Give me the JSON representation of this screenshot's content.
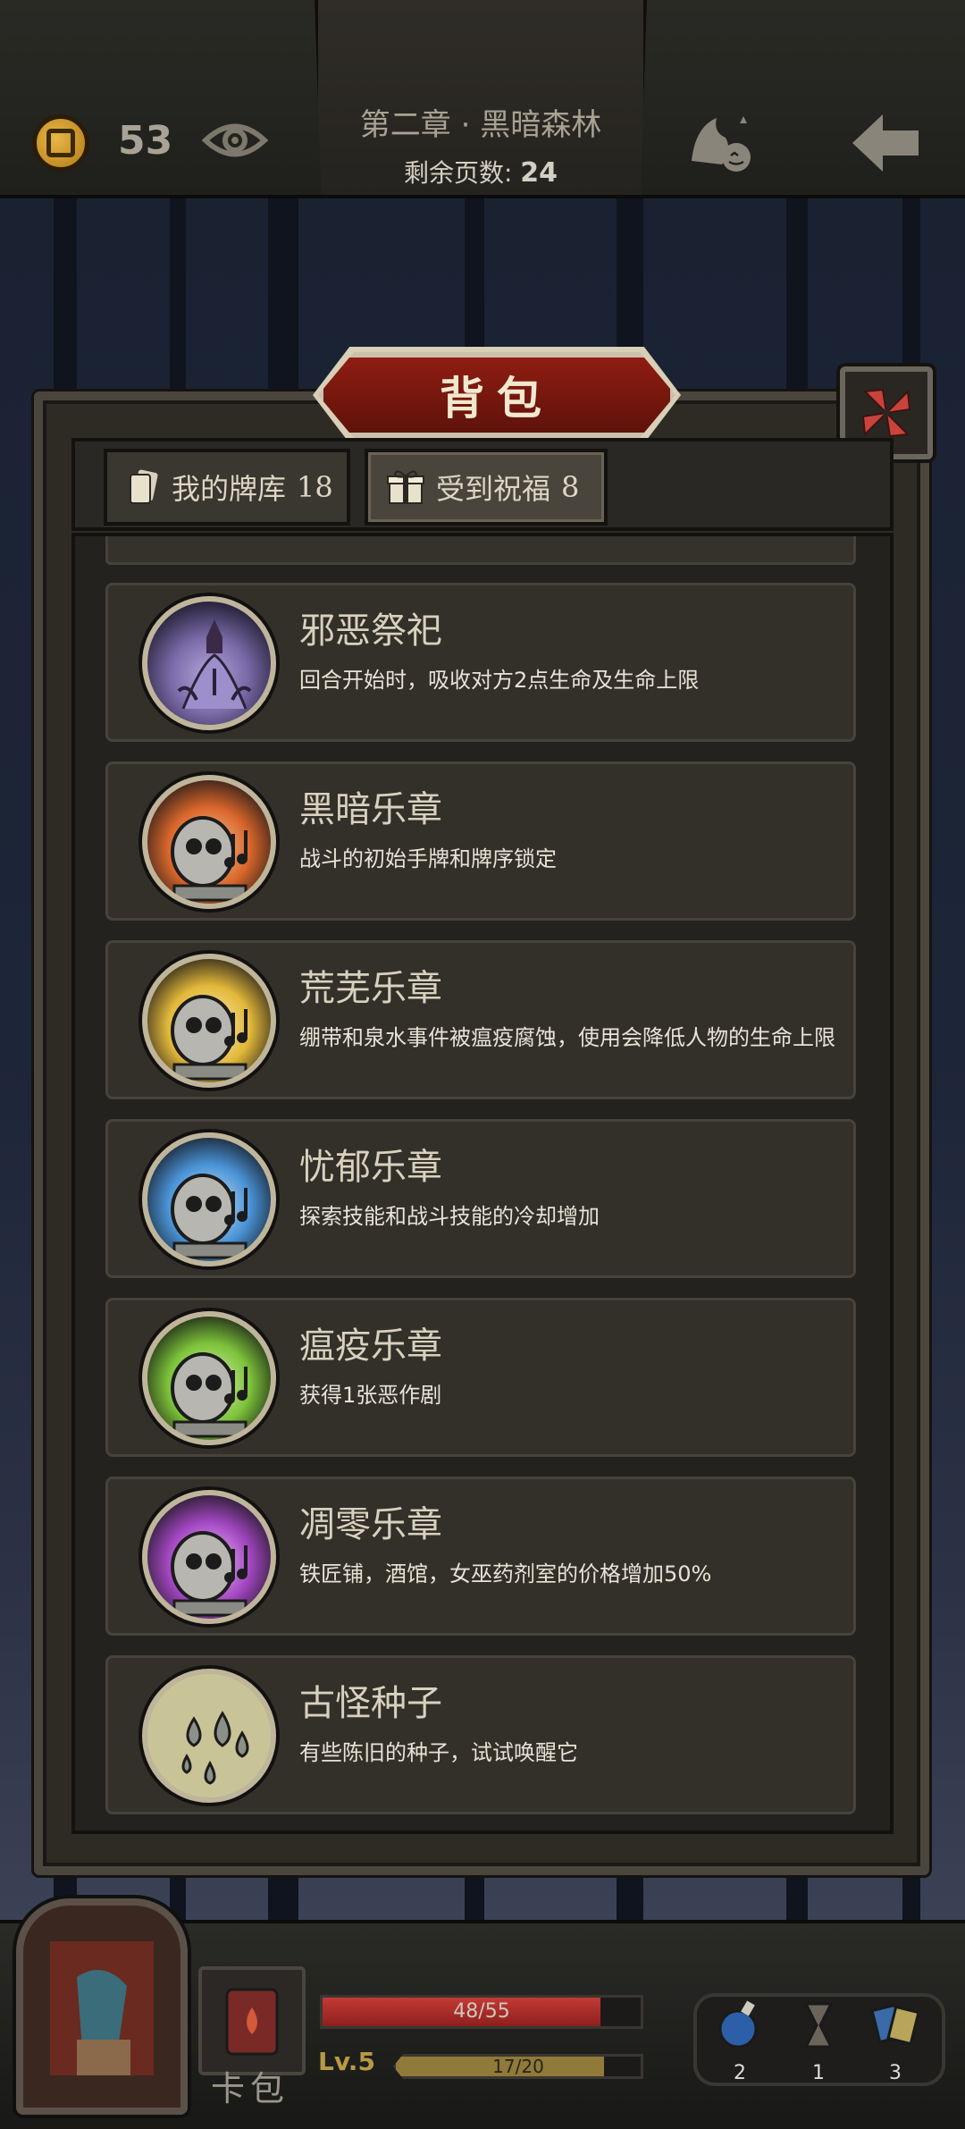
{
  "header": {
    "coins": "53",
    "chapter_title": "第二章 · 黑暗森林",
    "pages_label": "剩余页数:",
    "pages_value": "24"
  },
  "bag": {
    "title": "背包",
    "tabs": [
      {
        "label": "我的牌库",
        "count": "18",
        "icon": "card-icon"
      },
      {
        "label": "受到祝福",
        "count": "8",
        "icon": "gift-icon"
      }
    ],
    "items": [
      {
        "name": "邪恶祭祀",
        "desc": "回合开始时，吸收对方2点生命及生命上限",
        "icon": "cultist-tentacle-icon",
        "color": "#8f7fb8"
      },
      {
        "name": "黑暗乐章",
        "desc": "战斗的初始手牌和牌序锁定",
        "icon": "skull-organ-red-icon",
        "color": "#d8662a"
      },
      {
        "name": "荒芜乐章",
        "desc": "绷带和泉水事件被瘟疫腐蚀，使用会降低人物的生命上限",
        "icon": "skull-organ-yellow-icon",
        "color": "#e2b83a"
      },
      {
        "name": "忧郁乐章",
        "desc": "探索技能和战斗技能的冷却增加",
        "icon": "skull-organ-blue-icon",
        "color": "#4a93d6"
      },
      {
        "name": "瘟疫乐章",
        "desc": "获得1张恶作剧",
        "icon": "skull-organ-green-icon",
        "color": "#7cc23a"
      },
      {
        "name": "凋零乐章",
        "desc": "铁匠铺，酒馆，女巫药剂室的价格增加50%",
        "icon": "skull-organ-purple-icon",
        "color": "#a347c2"
      },
      {
        "name": "古怪种子",
        "desc": "有些陈旧的种子，试试唤醒它",
        "icon": "strange-seeds-icon",
        "color": "#c9c497"
      }
    ]
  },
  "hud": {
    "cardbag_label": "卡包",
    "hp_text": "48/55",
    "hp_fraction": 0.873,
    "level": "Lv.5",
    "xp_text": "17/20",
    "xp_fraction": 0.85,
    "inventory": [
      {
        "icon": "potion-icon",
        "count": "2"
      },
      {
        "icon": "hourglass-icon",
        "count": "1"
      },
      {
        "icon": "cards-icon",
        "count": "3"
      }
    ]
  }
}
